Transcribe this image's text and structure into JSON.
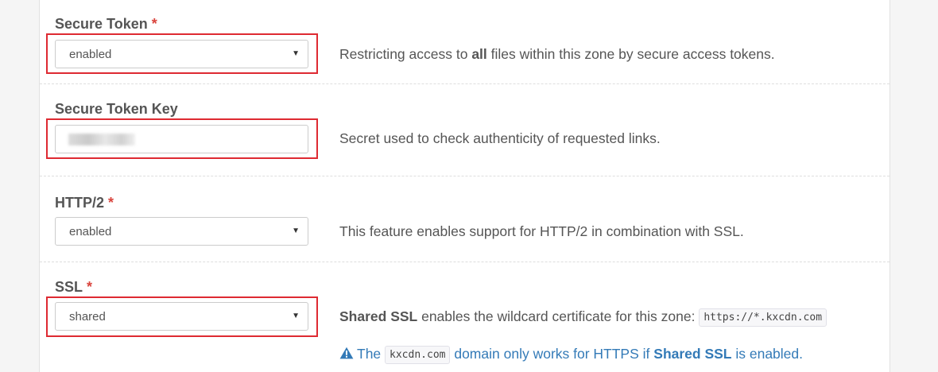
{
  "secure_token": {
    "label": "Secure Token",
    "required_mark": "*",
    "value": "enabled",
    "description_pre": "Restricting access to ",
    "description_bold": "all",
    "description_post": " files within this zone by secure access tokens."
  },
  "secure_token_key": {
    "label": "Secure Token Key",
    "description": "Secret used to check authenticity of requested links."
  },
  "http2": {
    "label": "HTTP/2",
    "required_mark": "*",
    "value": "enabled",
    "description": "This feature enables support for HTTP/2 in combination with SSL."
  },
  "ssl": {
    "label": "SSL",
    "required_mark": "*",
    "value": "shared",
    "description_bold": "Shared SSL",
    "description_post": " enables the wildcard certificate for this zone: ",
    "description_code": "https://*.kxcdn.com",
    "note_pre": "The ",
    "note_code": "kxcdn.com",
    "note_mid": " domain only works for HTTPS if ",
    "note_bold": "Shared SSL",
    "note_post": " is enabled."
  },
  "icons": {
    "select_caret": "▼",
    "warning": "warning-triangle-icon"
  },
  "colors": {
    "required": "#d9443d",
    "highlight_border": "#de2a32",
    "info_text": "#337ab7"
  }
}
